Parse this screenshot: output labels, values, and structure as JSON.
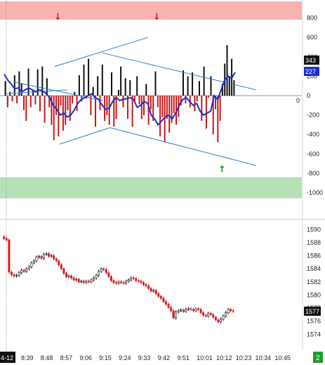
{
  "chart_data": [
    {
      "type": "bar",
      "name_hint": "oscillator panel",
      "ylim": [
        -1000,
        1000
      ],
      "y_ticks": [
        "800",
        "600",
        "400",
        "200",
        "0",
        "-200",
        "-400",
        "-600",
        "-800",
        "-1000"
      ],
      "zero_label": "0",
      "last_value_tags": [
        {
          "label": "343",
          "color": "#111111"
        },
        {
          "label": "227",
          "color": "#1a2fcf"
        }
      ],
      "overbought_zone": [
        800,
        1000
      ],
      "oversold_zone": [
        -800,
        -1000
      ],
      "bars": [
        150,
        -120,
        40,
        -60,
        210,
        -80,
        250,
        130,
        -150,
        -260,
        280,
        -120,
        60,
        -90,
        270,
        -160,
        300,
        -280,
        180,
        -120,
        -300,
        -460,
        -200,
        -420,
        -100,
        -360,
        -300,
        -150,
        -260,
        -80,
        40,
        -160,
        210,
        -60,
        320,
        -30,
        380,
        -200,
        90,
        -320,
        200,
        -150,
        320,
        -260,
        -200,
        -300,
        240,
        -320,
        -240,
        60,
        300,
        -120,
        180,
        -240,
        160,
        -320,
        -60,
        200,
        -90,
        -240,
        -200,
        120,
        -300,
        -140,
        -260,
        250,
        -120,
        -420,
        -220,
        -480,
        -240,
        -380,
        -280,
        -180,
        -300,
        -220,
        -100,
        260,
        -80,
        200,
        -120,
        240,
        -160,
        -60,
        150,
        -260,
        300,
        -340,
        -20,
        200,
        -400,
        -140,
        -480,
        -260,
        120,
        330,
        520,
        200,
        380,
        160
      ],
      "series": [
        {
          "name": "",
          "color": "#1a2fcf",
          "values": [
            220,
            160,
            120,
            70,
            80,
            40,
            60,
            80,
            60,
            40,
            60,
            50,
            20,
            -20,
            -100,
            -140,
            -200,
            -180,
            -220,
            -200,
            -150,
            -80,
            -40,
            -20,
            0,
            20,
            -20,
            -40,
            -100,
            -140,
            -130,
            -60,
            -20,
            -50,
            -40,
            -30,
            -20,
            -40,
            -120,
            -100,
            -60,
            -80,
            -200,
            -240,
            -300,
            -260,
            -220,
            -200,
            -240,
            -180,
            -100,
            -40,
            -20,
            -60,
            -100,
            -80,
            -160,
            -200,
            -180,
            -160,
            0,
            -40,
            60,
            160,
            200,
            180,
            240
          ]
        }
      ],
      "channel_lines": "up-channel and down-channel trendlines",
      "markers": [
        {
          "kind": "sell-arrow",
          "symbol": "↓",
          "color": "#d42020"
        },
        {
          "kind": "sell-arrow",
          "symbol": "↓",
          "color": "#d42020"
        },
        {
          "kind": "buy-arrow",
          "symbol": "↑",
          "color": "#1f8a2a"
        }
      ]
    },
    {
      "type": "candlestick",
      "name_hint": "price panel",
      "ylim": [
        1575,
        1591
      ],
      "y_ticks": [
        "1590",
        "1588",
        "1586",
        "1584",
        "1582",
        "1580",
        "1578",
        "1576",
        "1574"
      ],
      "last_value_tag": {
        "label": "1577",
        "color": "#111111"
      },
      "closes": [
        1588.6,
        1588.4,
        1583.5,
        1583.1,
        1582.9,
        1583.0,
        1583.4,
        1583.8,
        1583.6,
        1584.0,
        1584.3,
        1584.9,
        1585.2,
        1585.8,
        1585.9,
        1585.6,
        1586.2,
        1586.3,
        1585.9,
        1586.0,
        1585.5,
        1585.2,
        1584.6,
        1584.0,
        1583.3,
        1582.8,
        1582.9,
        1582.6,
        1582.3,
        1582.4,
        1582.0,
        1582.1,
        1581.9,
        1582.1,
        1582.0,
        1582.3,
        1582.6,
        1583.0,
        1583.6,
        1584.0,
        1583.9,
        1583.4,
        1582.8,
        1582.2,
        1581.9,
        1581.8,
        1582.0,
        1581.9,
        1581.8,
        1582.1,
        1582.3,
        1582.6,
        1582.5,
        1582.2,
        1582.1,
        1581.9,
        1581.6,
        1581.4,
        1581.0,
        1580.6,
        1580.7,
        1580.2,
        1579.8,
        1579.5,
        1579.0,
        1578.6,
        1578.1,
        1577.6,
        1576.5,
        1577.4,
        1577.6,
        1577.7,
        1577.5,
        1577.8,
        1577.9,
        1577.8,
        1577.6,
        1577.9,
        1577.8,
        1577.3,
        1576.9,
        1576.8,
        1577.2,
        1577.0,
        1576.6,
        1576.2,
        1575.9,
        1576.3,
        1576.8,
        1577.3,
        1577.8,
        1577.6,
        1577.5
      ]
    }
  ],
  "time_axis": {
    "first_label": "4-12",
    "labels": [
      "8:39",
      "8:48",
      "8:57",
      "9:06",
      "9:15",
      "9:24",
      "9:33",
      "9:42",
      "9:51",
      "10:01",
      "10:12",
      "10:23",
      "10:34",
      "10:45"
    ],
    "badge": "2"
  },
  "colors": {
    "up_candle": "#111111",
    "down_candle": "#d42020",
    "up_bar": "#111111",
    "down_bar": "#c81818",
    "overbought": "#f9b3b3",
    "oversold": "#b7e0b7",
    "channel": "#2b7fd4",
    "smooth_line": "#1a2fcf",
    "badge": "#1f9a2f"
  }
}
